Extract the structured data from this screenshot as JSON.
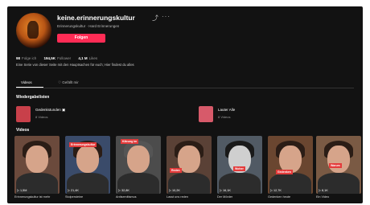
{
  "profile": {
    "username": "keine.erinnerungskultur",
    "subtitle": "Erinnerungskultur · Hard Erinnerungen",
    "follow_label": "Folgen",
    "share_icon": "share-icon",
    "more_icon": "more-icon"
  },
  "stats": {
    "following_count": "98",
    "following_label": "Folge ich",
    "followers_count": "194,5K",
    "followers_label": "Follower",
    "likes_count": "4,1 M",
    "likes_label": "Likes"
  },
  "bio": "Eine Serie von dieser Seite mit den Hauptsachen für euch; Hier findest du alles",
  "tabs": [
    {
      "label": "Videos",
      "active": true
    },
    {
      "label": "Gefällt mir",
      "active": false
    }
  ],
  "playlists_heading": "Wiedergabelisten",
  "playlists": [
    {
      "name": "Gedenkstunden",
      "count": "8 Videos",
      "color": "#c8404a"
    },
    {
      "name": "Lauter Alle",
      "count": "8 Videos",
      "color": "#d75a6a"
    }
  ],
  "videos_heading": "Videos",
  "videos": [
    {
      "title": "Erinnerungskultur ist mehr",
      "views": "1,5M",
      "caption": "",
      "bg": "#6b4a3c"
    },
    {
      "title": "Stolpersteine",
      "views": "21,4K",
      "caption": "Erinnerungskultur",
      "bg": "#3a4b6a"
    },
    {
      "title": "Antisemitismus",
      "views": "32,8K",
      "caption": "Klärung im",
      "bg": "#4c4c4c"
    },
    {
      "title": "Lasst uns reden",
      "views": "10,2K",
      "caption": "Reden",
      "bg": "#5a4136"
    },
    {
      "title": "Der Mörder",
      "views": "16,1K",
      "caption": "Woher",
      "bg": "#515a64"
    },
    {
      "title": "Gedenken heute",
      "views": "12,7K",
      "caption": "Gedenken",
      "bg": "#6a4630"
    },
    {
      "title": "Ein Video",
      "views": "8,1K",
      "caption": "Warum",
      "bg": "#7a5a44"
    }
  ]
}
